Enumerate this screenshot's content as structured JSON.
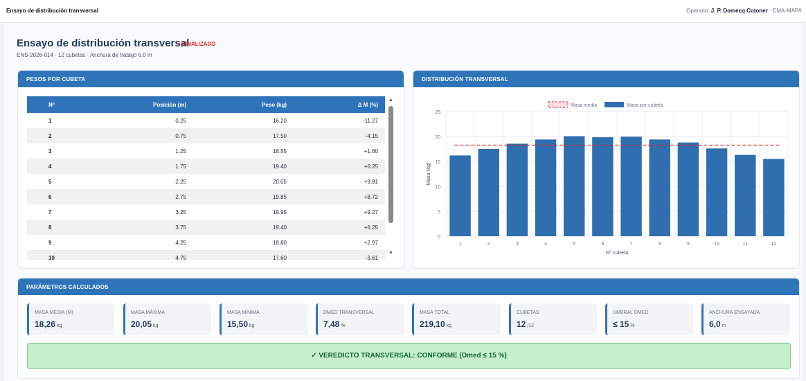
{
  "header": {
    "app_title": "Ensayo de distribución transversal",
    "operator_label": "Operario:",
    "operator_name": "J. P. Domecq Cotoner",
    "operator_org": "· EMA-MAPA"
  },
  "page": {
    "title": "Ensayo de distribución transversal",
    "status": "FINALIZADO",
    "status_color": "#dc2626",
    "subtitle": "ENS-2026-014 · 12 cubetas · Anchura de trabajo 6,0 m"
  },
  "weights_card": {
    "title": "PESOS POR CUBETA",
    "columns": [
      "Nº",
      "Posición (m)",
      "Peso (kg)",
      "Δ M (%)"
    ],
    "rows": [
      [
        "1",
        "0.25",
        "16.20",
        "-11.27"
      ],
      [
        "2",
        "0.75",
        "17.50",
        "-4.15"
      ],
      [
        "3",
        "1.25",
        "18.55",
        "+1.60"
      ],
      [
        "4",
        "1.75",
        "19.40",
        "+6.25"
      ],
      [
        "5",
        "2.25",
        "20.05",
        "+9.81"
      ],
      [
        "6",
        "2.75",
        "19.85",
        "+8.72"
      ],
      [
        "7",
        "3.25",
        "19.95",
        "+9.27"
      ],
      [
        "8",
        "3.75",
        "19.40",
        "+6.25"
      ],
      [
        "9",
        "4.25",
        "18.80",
        "+2.97"
      ],
      [
        "10",
        "4.75",
        "17.60",
        "-3.61"
      ]
    ]
  },
  "chart_card": {
    "title": "DISTRIBUCIÓN TRANSVERSAL"
  },
  "chart_data": {
    "type": "bar",
    "categories": [
      "1",
      "2",
      "3",
      "4",
      "5",
      "6",
      "7",
      "8",
      "9",
      "10",
      "11",
      "12"
    ],
    "series": [
      {
        "name": "Masa por cubeta",
        "values": [
          16.2,
          17.5,
          18.55,
          19.4,
          20.05,
          19.85,
          19.95,
          19.4,
          18.8,
          17.6,
          16.3,
          15.5
        ],
        "color": "#2f6fb0"
      }
    ],
    "reference_line": {
      "name": "Masa media",
      "value": 18.26,
      "color": "#dc2626"
    },
    "xlabel": "Nº cubeta",
    "ylabel": "Masa (kg)",
    "ylim": [
      0,
      25
    ],
    "yticks": [
      "0",
      "5",
      "10",
      "15",
      "20",
      "25"
    ],
    "grid": true,
    "legend": "top"
  },
  "params_card": {
    "title": "PARÁMETROS CALCULADOS",
    "items": [
      {
        "label": "MASA MEDIA (M̄)",
        "value": "18,26",
        "unit": "kg"
      },
      {
        "label": "MASA MÁXIMA",
        "value": "20,05",
        "unit": "kg"
      },
      {
        "label": "MASA MÍNIMA",
        "value": "15,50",
        "unit": "kg"
      },
      {
        "label": "DMED TRANSVERSAL",
        "value": "7,48",
        "unit": "%"
      },
      {
        "label": "MASA TOTAL",
        "value": "219,10",
        "unit": "kg"
      },
      {
        "label": "CUBETAS",
        "value": "12",
        "unit": "/12"
      },
      {
        "label": "UMBRAL DMED",
        "value": "≤ 15",
        "unit": "%"
      },
      {
        "label": "ANCHURA ENSAYADA",
        "value": "6,0",
        "unit": "m"
      }
    ],
    "verdict": "✓ VEREDICTO TRANSVERSAL: CONFORME (Dmed ≤ 15 %)"
  }
}
